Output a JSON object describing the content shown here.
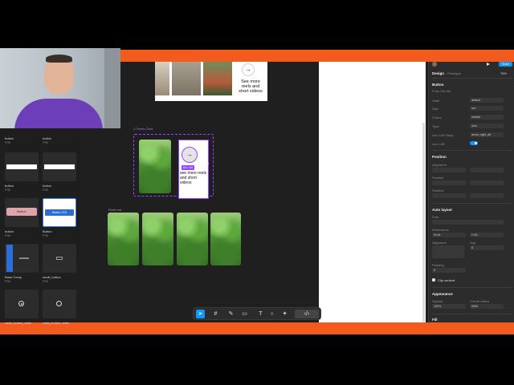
{
  "canvas": {
    "frame_label": "Reels Card",
    "section_label": "Reels list",
    "see_more_text": "See more reels and short videos",
    "see_more_text_small": "see more reels and short videos",
    "size_badge": "64 × 64",
    "arrow": "→"
  },
  "assets": [
    {
      "label": "button",
      "sub": "F95"
    },
    {
      "label": "button",
      "sub": "F95"
    },
    {
      "label": "button",
      "sub": "F95"
    },
    {
      "label": "button",
      "sub": "F95"
    },
    {
      "label": "button",
      "sub": "F95",
      "chip": "Button"
    },
    {
      "label": "Button",
      "sub": "F95",
      "chip": "Button CTA"
    },
    {
      "label": "Base Comp",
      "sub": "F95"
    },
    {
      "label": "small_button",
      "sub": "F95"
    },
    {
      "label": "radio_button_state",
      "sub": "F95"
    },
    {
      "label": "radio_button_state",
      "sub": "F95"
    }
  ],
  "right_panel": {
    "tabs": [
      "Design",
      "Prototype"
    ],
    "zoom": "75%",
    "share_label": "Share",
    "component_title": "Button",
    "from_file": "From this file",
    "props": [
      {
        "name": "State",
        "value": "default"
      },
      {
        "name": "Size",
        "value": "md"
      },
      {
        "name": "Colors",
        "value": "neutral"
      },
      {
        "name": "Type",
        "value": "icon"
      },
      {
        "name": "Icon Left Swap",
        "value": "arrow_right_alt"
      },
      {
        "name": "Icon Left",
        "value": ""
      }
    ],
    "position_label": "Position",
    "alignment_label": "Alignment",
    "position_sub": "Position",
    "rotation_label": "Rotation",
    "auto_layout_label": "Auto layout",
    "flow_label": "Flow",
    "dimensions_label": "Dimensions",
    "w_value": "64",
    "h_value": "64",
    "alignment2_label": "Alignment",
    "gap_label": "Gap",
    "gap_value": "8",
    "padding_label": "Padding",
    "padding_value": "8",
    "clip_label": "Clip content",
    "appearance_label": "Appearance",
    "opacity_label": "Opacity",
    "opacity_value": "100%",
    "radius_label": "Corner radius",
    "radius_value": "9999",
    "fill_label": "Fill"
  },
  "colors": {
    "accent": "#f25a1e",
    "selection": "#9747ff",
    "ui_blue": "#0d99ff"
  }
}
